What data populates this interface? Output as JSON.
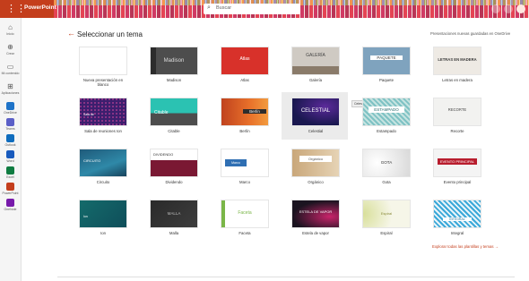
{
  "app": {
    "name": "PowerPoint"
  },
  "search": {
    "placeholder": "Buscar"
  },
  "rail": [
    {
      "icon": "home-icon",
      "label": "Inicio"
    },
    {
      "icon": "create-icon",
      "label": "Crear"
    },
    {
      "icon": "folder-icon",
      "label": "Mi contenido"
    },
    {
      "icon": "apps-icon",
      "label": "Aplicaciones"
    },
    {
      "icon": "onedrive-icon",
      "label": "OneDrive"
    },
    {
      "icon": "teams-icon",
      "label": "Teams"
    },
    {
      "icon": "outlook-icon",
      "label": "Outlook"
    },
    {
      "icon": "word-icon",
      "label": "Word"
    },
    {
      "icon": "excel-icon",
      "label": "Excel"
    },
    {
      "icon": "powerpoint-icon",
      "label": "PowerPoint"
    },
    {
      "icon": "onenote-icon",
      "label": "OneNote"
    }
  ],
  "header": {
    "title": "Seleccionar un tema",
    "save_note": "Presentaciones nuevas guardadas en OneDrive"
  },
  "tooltip": "Celestial",
  "more_link": "Explorar todas las plantillas y temas  →",
  "themes": [
    {
      "name": "Nueva presentación en blanco",
      "label": ""
    },
    {
      "name": "Madison",
      "label": "Madison"
    },
    {
      "name": "Atlas",
      "label": "Atlas"
    },
    {
      "name": "Galería",
      "label": "GALERÍA"
    },
    {
      "name": "Paquete",
      "label": "PAQUETE"
    },
    {
      "name": "Letras en madera",
      "label": "LETRAS EN MADERA"
    },
    {
      "name": "Sala de reuniones Ion",
      "label": "Sala de"
    },
    {
      "name": "Citable",
      "label": "Citable"
    },
    {
      "name": "Berlín",
      "label": "Berlín"
    },
    {
      "name": "Celestial",
      "label": "CELESTIAL"
    },
    {
      "name": "Estampado",
      "label": "ESTAMPADO"
    },
    {
      "name": "Recorte",
      "label": "RECORTE"
    },
    {
      "name": "Circuito",
      "label": "CIRCUITO"
    },
    {
      "name": "Dividendo",
      "label": "DIVIDENDO"
    },
    {
      "name": "Marco",
      "label": "Marco"
    },
    {
      "name": "Orgánico",
      "label": "Orgánico"
    },
    {
      "name": "Gota",
      "label": "GOTA"
    },
    {
      "name": "Evento principal",
      "label": "EVENTO PRINCIPAL"
    },
    {
      "name": "Ion",
      "label": "Ion"
    },
    {
      "name": "Malla",
      "label": "MALLA"
    },
    {
      "name": "Faceta",
      "label": "Faceta"
    },
    {
      "name": "Estela de vapor",
      "label": "ESTELA DE VAPOR"
    },
    {
      "name": "Espiral",
      "label": "Espiral"
    },
    {
      "name": "Integral",
      "label": "INTEGRAL"
    }
  ]
}
